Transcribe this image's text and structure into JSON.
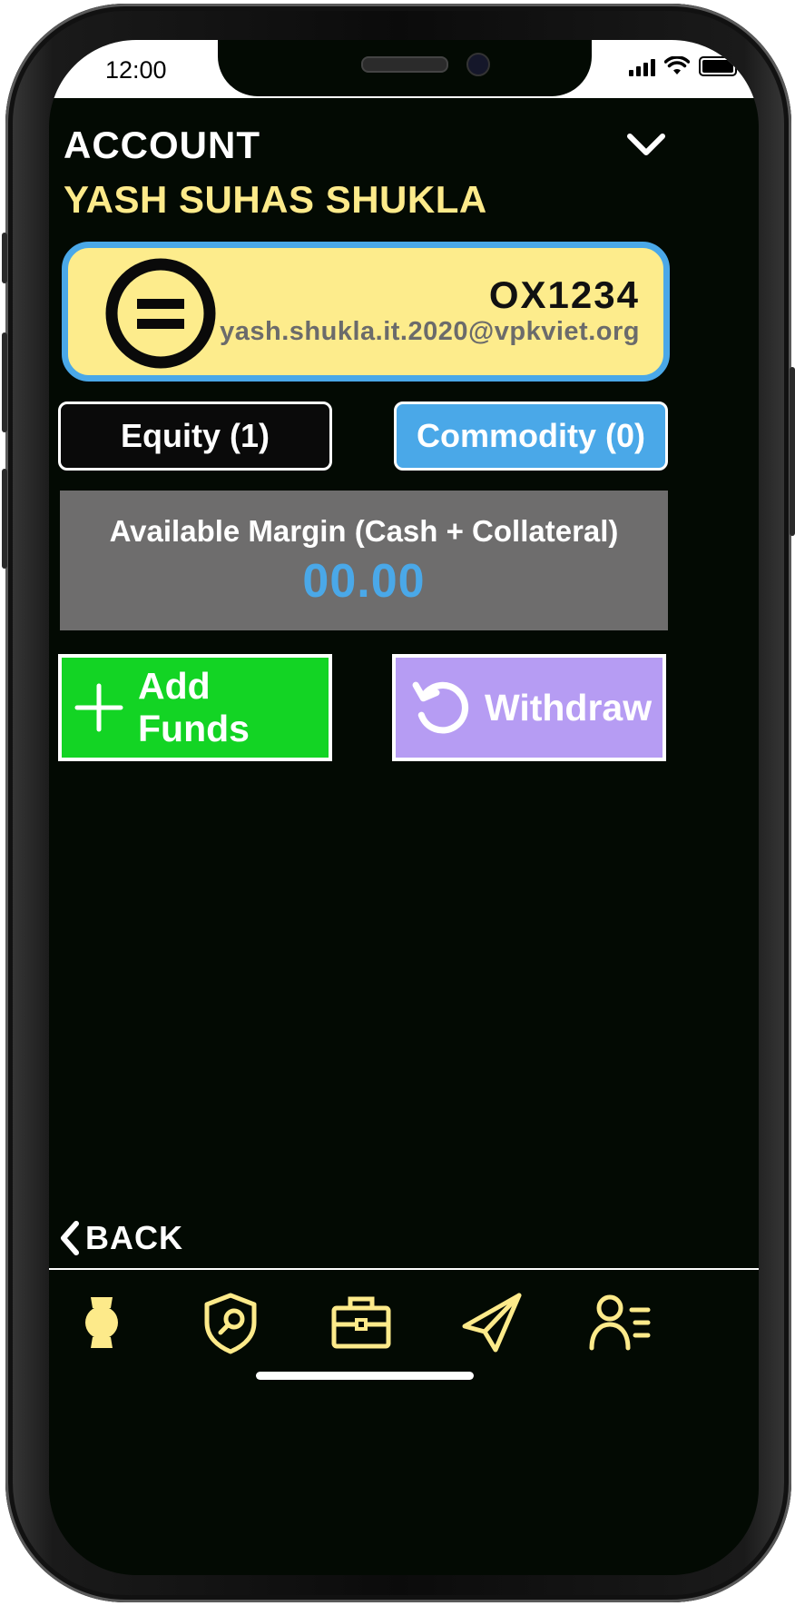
{
  "status_bar": {
    "time": "12:00"
  },
  "header": {
    "title": "ACCOUNT",
    "user_name": "YASH SUHAS SHUKLA"
  },
  "profile": {
    "client_id": "OX1234",
    "email": "yash.shukla.it.2020@vpkviet.org"
  },
  "segments": {
    "equity_label": "Equity (1)",
    "commodity_label": "Commodity (0)",
    "selected": "Commodity"
  },
  "margin": {
    "label": "Available Margin (Cash + Collateral)",
    "value": "00.00"
  },
  "actions": {
    "add_funds_label": "Add Funds",
    "withdraw_label": "Withdraw"
  },
  "back_label": "BACK",
  "bottom_nav": [
    {
      "icon": "watch-icon"
    },
    {
      "icon": "shield-search-icon"
    },
    {
      "icon": "briefcase-icon"
    },
    {
      "icon": "send-icon"
    },
    {
      "icon": "user-list-icon"
    }
  ],
  "colors": {
    "background": "#030a03",
    "accent_yellow": "#fdec8c",
    "accent_blue": "#4aa8e8",
    "add_green": "#13d424",
    "withdraw_purple": "#b69cf3",
    "panel_gray": "#6e6d6d"
  }
}
